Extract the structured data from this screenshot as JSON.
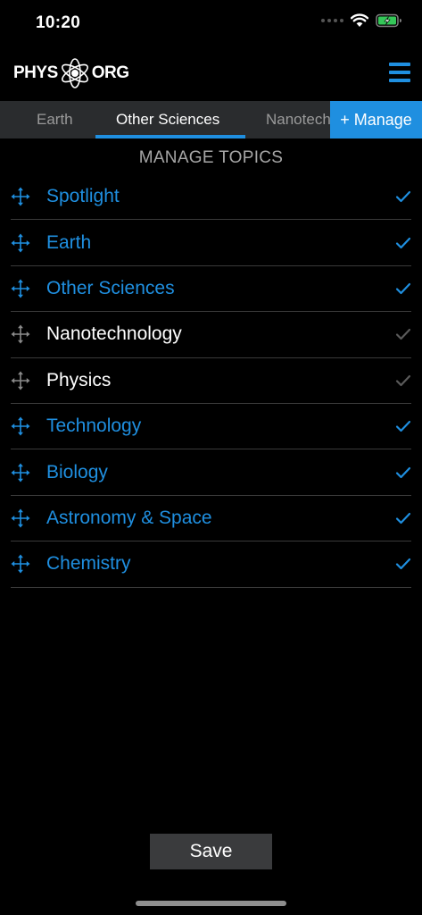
{
  "status_bar": {
    "time": "10:20"
  },
  "header": {
    "logo_left": "PHYS",
    "logo_right": "ORG"
  },
  "tabs": [
    {
      "label": "Earth",
      "active": false
    },
    {
      "label": "Other Sciences",
      "active": true
    },
    {
      "label": "Nanotech",
      "active": false
    }
  ],
  "manage_button": "+ Manage",
  "section_title": "MANAGE TOPICS",
  "topics": [
    {
      "label": "Spotlight",
      "selected": true
    },
    {
      "label": "Earth",
      "selected": true
    },
    {
      "label": "Other Sciences",
      "selected": true
    },
    {
      "label": "Nanotechnology",
      "selected": false
    },
    {
      "label": "Physics",
      "selected": false
    },
    {
      "label": "Technology",
      "selected": true
    },
    {
      "label": "Biology",
      "selected": true
    },
    {
      "label": "Astronomy & Space",
      "selected": true
    },
    {
      "label": "Chemistry",
      "selected": true
    }
  ],
  "save_button": "Save",
  "colors": {
    "accent": "#1f8fe0",
    "inactive_icon": "#8a8a8a",
    "background": "#000000"
  },
  "icons": {
    "drag": "move-arrows-icon",
    "check": "checkmark-icon",
    "menu": "hamburger-menu-icon",
    "wifi": "wifi-icon",
    "battery": "battery-charging-icon"
  }
}
